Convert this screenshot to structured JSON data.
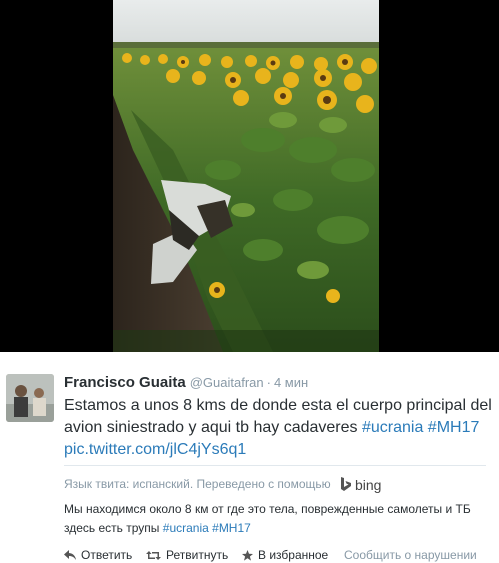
{
  "tweet": {
    "author_name": "Francisco Guaita",
    "author_handle": "@Guaitafran",
    "separator": "·",
    "timestamp": "4 мин",
    "text_main": "Estamos a unos 8 kms de donde esta el cuerpo principal del avion siniestrado y aqui tb hay cadaveres",
    "hashtag_1": "#ucrania",
    "hashtag_2": "#MH17",
    "media_link": "pic.twitter.com/jlC4jYs6q1"
  },
  "translation": {
    "label": "Язык твита: испанский. Переведено с помощью",
    "provider": "bing",
    "text_main": "Мы находимся около 8 км от где это тела, поврежденные самолеты и ТБ здесь есть трупы",
    "hashtag_1": "#ucrania",
    "hashtag_2": "#MH17"
  },
  "actions": {
    "reply": "Ответить",
    "retweet": "Ретвитнуть",
    "favorite": "В избранное",
    "report": "Сообщить о нарушении"
  },
  "colors": {
    "link": "#2b7bb9",
    "muted": "#8899a6",
    "text": "#292f33"
  },
  "icons": {
    "reply": "reply-arrow-icon",
    "retweet": "retweet-icon",
    "favorite": "star-icon",
    "translator": "bing-logo-icon"
  }
}
